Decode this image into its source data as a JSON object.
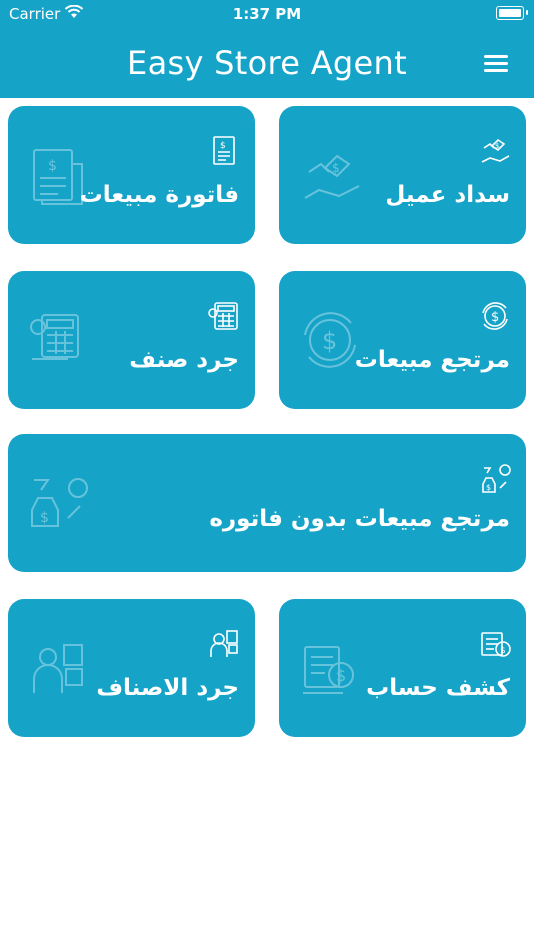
{
  "status_bar": {
    "carrier": "Carrier",
    "time": "1:37 PM"
  },
  "header": {
    "title": "Easy Store Agent",
    "menu_icon": "hamburger-menu-icon"
  },
  "colors": {
    "primary": "#16a3c8",
    "text": "#ffffff",
    "background": "#ffffff"
  },
  "tiles": [
    {
      "label": "سداد عميل",
      "icon": "hand-payment-icon"
    },
    {
      "label": "فاتورة مبيعات",
      "icon": "receipt-icon"
    },
    {
      "label": "مرتجع مبيعات",
      "icon": "dollar-refresh-icon"
    },
    {
      "label": "جرد صنف",
      "icon": "calculator-icon"
    },
    {
      "label": "مرتجع مبيعات بدون فاتوره",
      "icon": "money-bag-return-icon"
    },
    {
      "label": "كشف حساب",
      "icon": "account-statement-icon"
    },
    {
      "label": "جرد الاصناف",
      "icon": "inventory-worker-icon"
    }
  ]
}
